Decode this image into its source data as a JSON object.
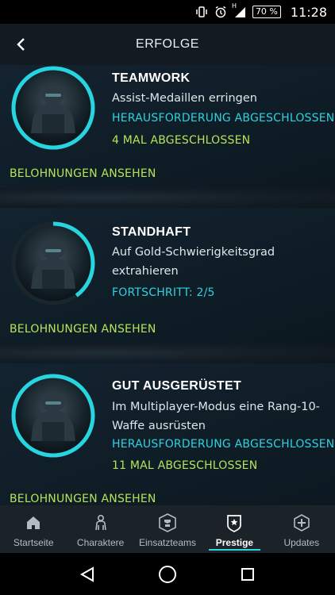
{
  "status_bar": {
    "battery": "70 %",
    "network_indicator": "H",
    "time": "11:28",
    "icons": [
      "vibrate-icon",
      "alarm-icon",
      "signal-icon",
      "battery-icon"
    ]
  },
  "header": {
    "title": "ERFOLGE",
    "back_icon": "back-arrow-icon"
  },
  "achievements": [
    {
      "title": "TEAMWORK",
      "description": "Assist-Medaillen erringen",
      "status": "HERAUSFORDERUNG ABGESCHLOSSEN",
      "completed_count": "4 MAL ABGESCHLOSSEN",
      "rewards_link": "BELOHNUNGEN ANSEHEN",
      "progress": 1.0
    },
    {
      "title": "STANDHAFT",
      "description": "Auf Gold-Schwierigkeitsgrad extrahieren",
      "progress_text": "FORTSCHRITT: 2/5",
      "rewards_link": "BELOHNUNGEN ANSEHEN",
      "progress": 0.4
    },
    {
      "title": "GUT AUSGERÜSTET",
      "description": "Im Multiplayer-Modus eine Rang-10-Waffe ausrüsten",
      "status": "HERAUSFORDERUNG ABGESCHLOSSEN",
      "completed_count": "11 MAL ABGESCHLOSSEN",
      "rewards_link": "BELOHNUNGEN ANSEHEN",
      "progress": 1.0
    }
  ],
  "bottom_nav": {
    "items": [
      {
        "label": "Startseite",
        "icon": "home-icon"
      },
      {
        "label": "Charaktere",
        "icon": "character-icon"
      },
      {
        "label": "Einsatzteams",
        "icon": "strike-team-icon"
      },
      {
        "label": "Prestige",
        "icon": "prestige-icon"
      },
      {
        "label": "Updates",
        "icon": "updates-icon"
      }
    ],
    "active": "Prestige"
  },
  "android_nav": {
    "icons": [
      "back-triangle-icon",
      "home-circle-icon",
      "recents-square-icon"
    ]
  },
  "colors": {
    "accent_cyan": "#2ed2e0",
    "accent_green": "#b5e35a",
    "header_bg": "#121b22",
    "nav_bg": "#1b2329"
  }
}
